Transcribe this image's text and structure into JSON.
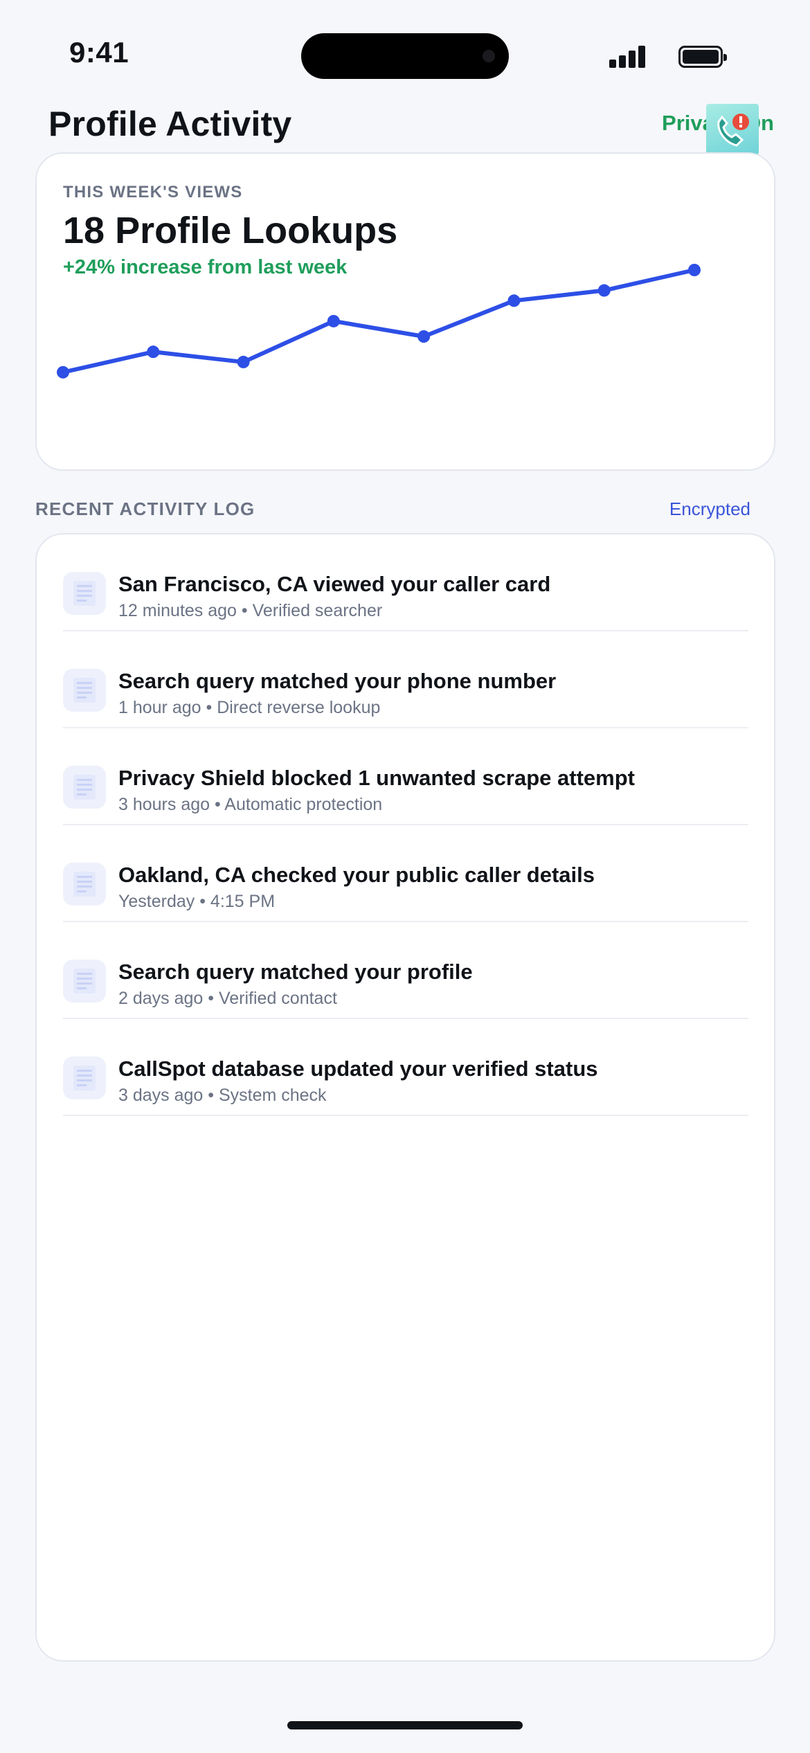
{
  "status_bar": {
    "time": "9:41"
  },
  "header": {
    "title": "Profile Activity",
    "privacy_label": "Privacy On"
  },
  "weekly": {
    "eyebrow": "THIS WEEK'S VIEWS",
    "headline": "18 Profile Lookups",
    "delta": "+24% increase from last week"
  },
  "chart_data": {
    "type": "line",
    "x": [
      1,
      2,
      3,
      4,
      5,
      6,
      7,
      8
    ],
    "series": [
      {
        "values": [
          3,
          5,
          4,
          8,
          6.5,
          10,
          11,
          13
        ]
      }
    ],
    "ylim": [
      0,
      13
    ],
    "grid": false,
    "legend": "none",
    "color": "#2d4fe6"
  },
  "activity": {
    "section_title": "RECENT ACTIVITY LOG",
    "section_tag": "Encrypted",
    "items": [
      {
        "title": "San Francisco, CA viewed your caller card",
        "meta": "12 minutes ago • Verified searcher"
      },
      {
        "title": "Search query matched your phone number",
        "meta": "1 hour ago • Direct reverse lookup"
      },
      {
        "title": "Privacy Shield blocked 1 unwanted scrape attempt",
        "meta": "3 hours ago • Automatic protection"
      },
      {
        "title": "Oakland, CA checked your public caller details",
        "meta": "Yesterday • 4:15 PM"
      },
      {
        "title": "Search query matched your profile",
        "meta": "2 days ago • Verified contact"
      },
      {
        "title": "CallSpot database updated your verified status",
        "meta": "3 days ago • System check"
      }
    ]
  },
  "colors": {
    "accent": "#2d4fe6",
    "positive": "#1f9e5b",
    "muted": "#6b7384",
    "link": "#3a55d9"
  },
  "icons": {
    "app": "phone-alert-icon",
    "item": "document-list-icon"
  }
}
